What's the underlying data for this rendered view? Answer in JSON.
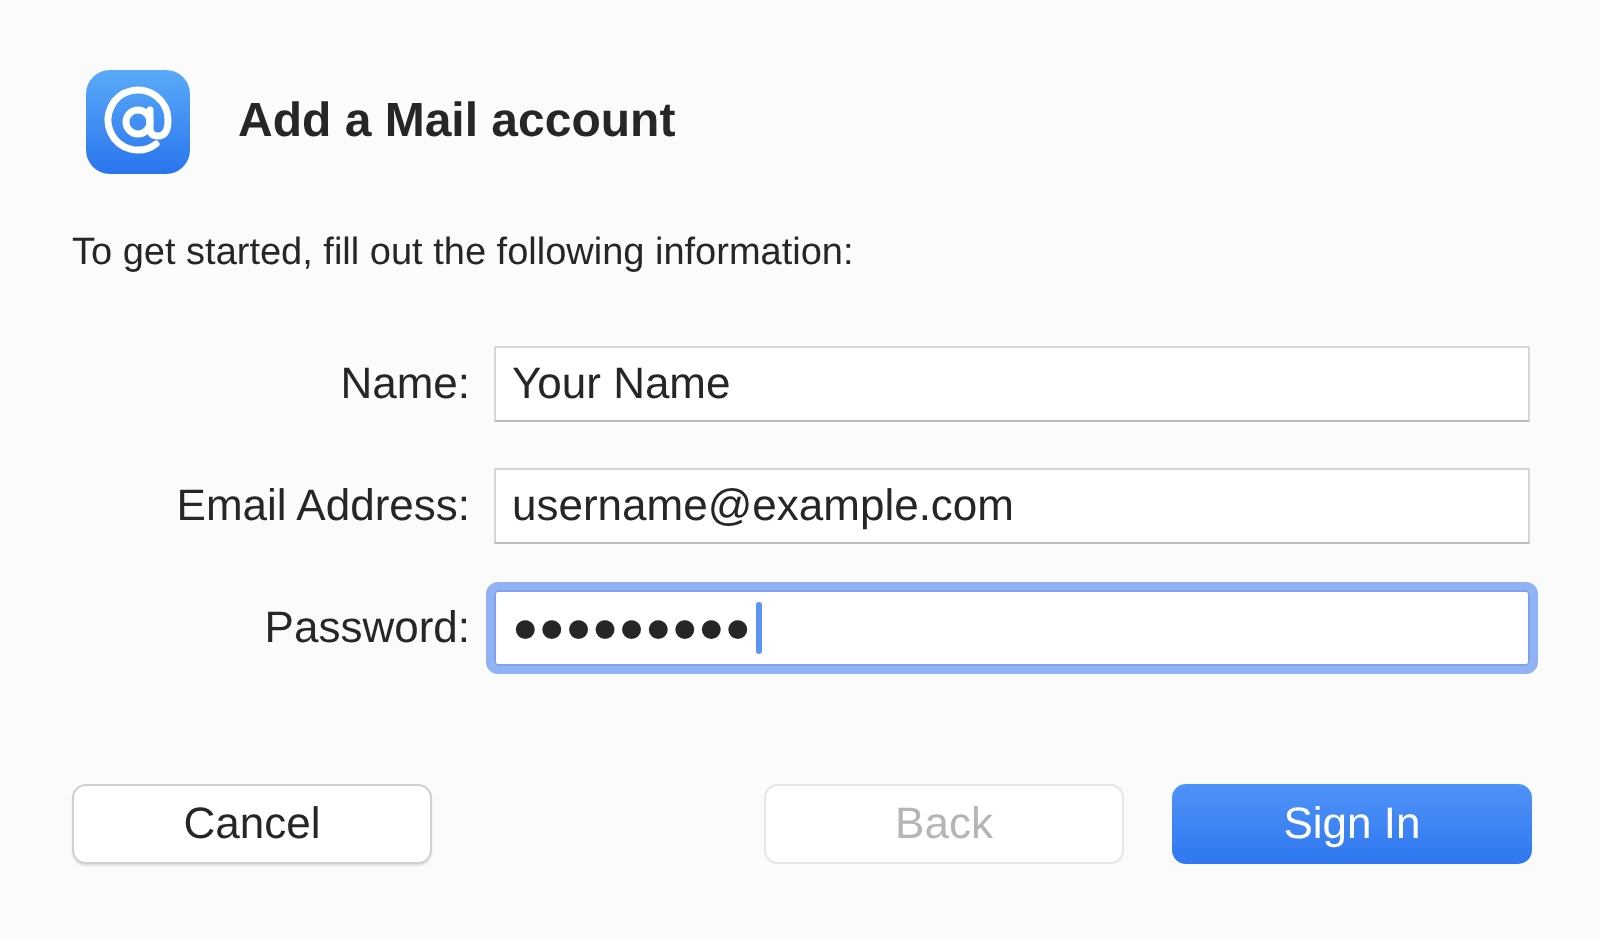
{
  "header": {
    "title": "Add a Mail account"
  },
  "instructions": "To get started, fill out the following information:",
  "fields": [
    {
      "label": "Name:",
      "value": "Your Name",
      "focused": false
    },
    {
      "label": "Email Address:",
      "value": "username@example.com",
      "focused": false
    },
    {
      "label": "Password:",
      "value": "●●●●●●●●●",
      "focused": true
    }
  ],
  "buttons": [
    {
      "label": "Cancel",
      "kind": "normal",
      "disabled": false
    },
    {
      "label": "Back",
      "kind": "normal",
      "disabled": true
    },
    {
      "label": "Sign In",
      "kind": "default",
      "disabled": false
    }
  ]
}
